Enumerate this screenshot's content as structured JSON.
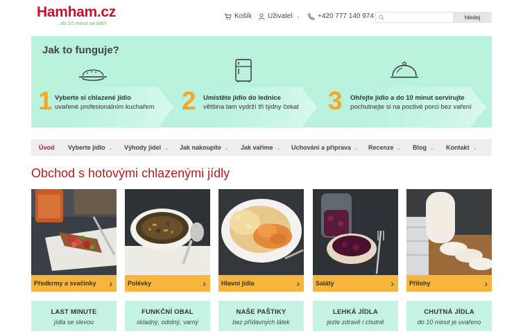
{
  "header": {
    "logo_title": "Hamham.cz",
    "logo_subtitle": "...do 10 minut na talíři",
    "cart_label": "Košík",
    "user_label": "Uživatel",
    "phone": "+420 777 140 974",
    "search_placeholder": "",
    "search_button": "hledej"
  },
  "how_it_works": {
    "title": "Jak to funguje?",
    "steps": [
      {
        "number": "1",
        "title": "Vyberte si chlazené jídlo",
        "desc": "uvařené profesionálním kuchařem",
        "icon": "plate-icon"
      },
      {
        "number": "2",
        "title": "Umístěte jídlo do lednice",
        "desc": "většina tam vydrží tři týdny čekat",
        "icon": "fridge-icon"
      },
      {
        "number": "3",
        "title": "Ohřejte jídlo a do 10 minut servírujte",
        "desc": "pochutnejte si na poctivé porci bez vaření",
        "icon": "cloche-icon"
      }
    ]
  },
  "main_nav": [
    {
      "label": "Úvod",
      "active": true
    },
    {
      "label": "Vyberte jídlo"
    },
    {
      "label": "Výhody jídel"
    },
    {
      "label": "Jak nakoupíte"
    },
    {
      "label": "Jak vaříme"
    },
    {
      "label": "Uchování a příprava"
    },
    {
      "label": "Recenze"
    },
    {
      "label": "Blog"
    },
    {
      "label": "Kontakt"
    }
  ],
  "shop": {
    "title": "Obchod s hotovými chlazenými jídly",
    "categories": [
      {
        "label": "Předkrmy a svačinky"
      },
      {
        "label": "Polévky"
      },
      {
        "label": "Hlavní jídla"
      },
      {
        "label": "Saláty"
      },
      {
        "label": "Přílohy"
      }
    ]
  },
  "promos": [
    {
      "title": "LAST MINUTE",
      "subtitle": "jídla se slevou"
    },
    {
      "title": "FUNKČNÍ OBAL",
      "subtitle": "skladný, odolný, varný"
    },
    {
      "title": "NAŠE PAŠTIKY",
      "subtitle": "bez přídavných látek"
    },
    {
      "title": "LEHKÁ JÍDLA",
      "subtitle": "jezte zdravě i chutně"
    },
    {
      "title": "CHUTNÁ JÍDLA",
      "subtitle": "do 10 minut je uvařeno"
    }
  ],
  "colors": {
    "brand_red": "#c8102e",
    "brand_green": "#6bb54a",
    "mint": "#b8f2dd",
    "step_orange": "#f5a623",
    "card_bar": "#f7b53d"
  }
}
